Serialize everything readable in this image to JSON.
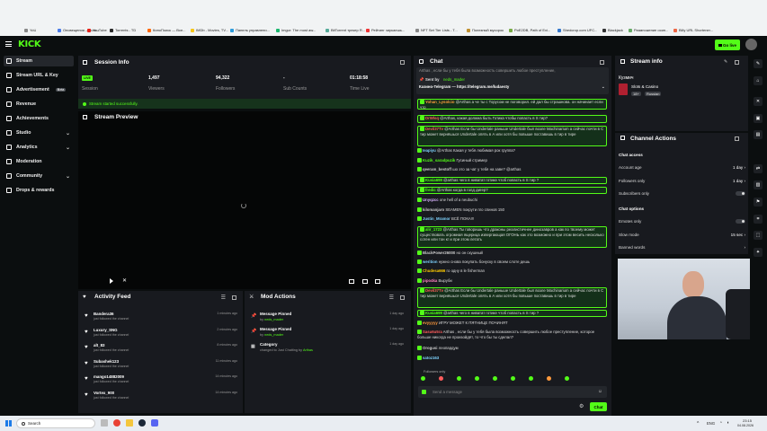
{
  "bookmarks": [
    "YoU",
    "Оповещения – Dum...",
    "YouTube",
    "Torrents - TD",
    "КиноПоиск — Все...",
    "IMDb - Movies, TV...",
    "Панель управлени...",
    "Imgur: The most aw...",
    "BitTorrent трекер R...",
    "Рейтинг чиркаешь...",
    "NFT Set Tier Lists - T...",
    "Полезный мусорок",
    "PoE2DB, Path of Exi...",
    "Shedcrop.com UFC...",
    "Blackjack",
    "Размножение осин...",
    "Billy URL Shortener..."
  ],
  "topbar": {
    "logo": "KICK",
    "go_live": "Go live"
  },
  "sidebar": {
    "items": [
      {
        "label": "Stream",
        "active": true
      },
      {
        "label": "Stream URL & Key"
      },
      {
        "label": "Advertisement",
        "badge": "Beta"
      },
      {
        "label": "Revenue"
      },
      {
        "label": "Achievements"
      },
      {
        "label": "Studio",
        "chev": true
      },
      {
        "label": "Analytics",
        "chev": true
      },
      {
        "label": "Moderation"
      },
      {
        "label": "Community",
        "chev": true
      },
      {
        "label": "Drops & rewards"
      }
    ]
  },
  "session": {
    "title": "Session Info",
    "live": "LIVE",
    "session_label": "Session",
    "viewers": "1,497",
    "viewers_label": "Viewers",
    "followers": "94,322",
    "followers_label": "Followers",
    "subs": "-",
    "subs_label": "Sub Counts",
    "time": "01:18:58",
    "time_label": "Time Live",
    "status": "Stream started successfully."
  },
  "preview": {
    "title": "Stream Preview"
  },
  "activity": {
    "title": "Activity Feed",
    "rows": [
      {
        "name": "Bandera36",
        "sub": "just followed the channel",
        "time": "1 minutes ago"
      },
      {
        "name": "Luxury_SNG",
        "sub": "just followed the channel",
        "time": "2 minutes ago"
      },
      {
        "name": "alt_83",
        "sub": "just followed the channel",
        "time": "8 minutes ago"
      },
      {
        "name": "Subashek123",
        "sub": "just followed the channel",
        "time": "11 minutes ago"
      },
      {
        "name": "mango14882009",
        "sub": "just followed the channel",
        "time": "14 minutes ago"
      },
      {
        "name": "Vortex_900",
        "sub": "just followed the channel",
        "time": "14 minutes ago"
      }
    ]
  },
  "mod": {
    "title": "Mod Actions",
    "rows": [
      {
        "name": "Message Pinned",
        "by": "by",
        "who": "neds_mader",
        "time": "1 day ago"
      },
      {
        "name": "Message Pinned",
        "by": "by",
        "who": "neds_mader",
        "time": "1 day ago"
      },
      {
        "name": "Category",
        "by": "changed to Just Chatting by",
        "who": "Arthas",
        "time": "1 day ago"
      }
    ]
  },
  "chat": {
    "title": "Chat",
    "pinned_top": "Arthas , если бы у тебя была возможность совершить любое преступление,",
    "pinned_by": "Sent by",
    "pinned_user": "neds_mader",
    "pinned_text": "Казино-Telegram — https://telegram.me/ludaesty",
    "lines": [
      {
        "user": "Yohan_Lysolcio",
        "text": "@Arthas а че ты с Торусом не поговорил. ей дал бы страшнова. он начинает если что",
        "hl": true,
        "col": "#ff9a3d"
      },
      {
        "user": "DrWlsq",
        "text": "@Arthas, какая должна быть Готика чтобы попасть в S тир?",
        "hl": true,
        "col": "#ff5c5c"
      },
      {
        "user": "Devil37Tv",
        "text": "@Arthas Если бы Undertale раньше Undertale был возле Machinarium а сейчас почти в С тир может вернёшься Undertale опять в А или хотя бы повыше поставишь в тир в тире",
        "hl": true,
        "col": "#ff5c5c"
      },
      {
        "user": "Ieapiyu",
        "text": "@Arthas Какая у тебя любимая рок группа?",
        "hl": false,
        "col": "#7fd4ff"
      },
      {
        "user": "Kuzik_saradpuzik",
        "text": "Гусиный стример",
        "hl": false,
        "col": "#53fc18"
      },
      {
        "user": "qeeram_bestoff",
        "text": "шо это за чат у тебя на заве? @arthas",
        "hl": false,
        "col": "#ccc"
      },
      {
        "user": "Kusia699",
        "text": "@arthas чего в ниватат готике чтоб попасть в S тир ?",
        "hl": true,
        "col": "#53fc18"
      },
      {
        "user": "fredic",
        "text": "@Arthas когда в голд дигер?",
        "hl": true,
        "col": "#53fc18"
      },
      {
        "user": "Unyqzcc",
        "text": "one hell of a neubuchi",
        "hl": false,
        "col": "#d9b3ff"
      },
      {
        "user": "kilomanjaro",
        "text": "SEAMEN покрути пго спинов 150",
        "hl": false,
        "col": "#ccc"
      },
      {
        "user": "Justin_Mramor",
        "text": "ВСЁ ПОКА!!!",
        "hl": false,
        "col": "#7fd4ff"
      },
      {
        "user": "alir_1723",
        "text": "@Arthas Ты говоришь что драконы реалистичнее динозавров а как по твоему может существовать огромная ящерица извергающая ОГОНЬ как это возможно и при этом весить несколько сотен или тон кг и при этом летать",
        "hl": true,
        "col": "#53fc18"
      },
      {
        "user": "BlackPower26000",
        "text": "но он скушный",
        "hl": false,
        "col": "#ccc"
      },
      {
        "user": "werition",
        "text": "нужно снова покупать бонуску в своем слоте дешь",
        "hl": false,
        "col": "#7fd4ff"
      },
      {
        "user": "Chudesa666",
        "text": "го одну в le fisherman",
        "hl": false,
        "col": "#ffcc00"
      },
      {
        "user": "pipo4ka",
        "text": "Выруби",
        "hl": false,
        "col": "#ff80c0"
      },
      {
        "user": "Devil37Tv",
        "text": "@Arthas Если бы Undertale раньше Undertale был возле Machinarium а сейчас почти в С тир может вернёшься Undertale опять в А или хотя бы повыше поставишь в тир в тире",
        "hl": true,
        "col": "#ff5c5c"
      },
      {
        "user": "Kusia699",
        "text": "@arthas чего в ниватат готике чтоб попасть в S тир ?",
        "hl": true,
        "col": "#53fc18"
      },
      {
        "user": "evyyyyy",
        "text": "ИГРУ МОЖЕТ К ПЯТНИЦЕ ПОЧИНЯТ",
        "hl": false,
        "col": "#ff9a3d"
      },
      {
        "user": "Sasu6u5ra",
        "text": "Arthas , если бы у тебя была возможность совершить любое преступление, которое больше никогда не произойдёт, то что бы ты сделал?",
        "hl": false,
        "col": "#ff5c5c"
      },
      {
        "user": "Orogusi",
        "text": "леопардум",
        "hl": false,
        "col": "#ccc"
      },
      {
        "user": "satoz163",
        "text": "",
        "hl": false,
        "col": "#7fd4ff"
      }
    ],
    "followers_only": "Followers only",
    "placeholder": "Send a message",
    "send": "Chat"
  },
  "stream_info": {
    "title": "Stream info",
    "user": "Кузмич",
    "category": "Slots & Casino",
    "tag1": "18+",
    "tag2": "Russian"
  },
  "channel_actions": {
    "title": "Channel Actions",
    "chat_access": "Chat access",
    "account_age": "Account age",
    "account_age_val": "1 day",
    "followers_only": "Followers only",
    "followers_only_val": "1 day",
    "subs_only": "Subscribers only",
    "chat_options": "Chat options",
    "emotes_only": "Emotes only",
    "slow_mode": "Slow mode",
    "slow_mode_val": "15 sec",
    "banned_words": "Banned words"
  },
  "taskbar": {
    "search": "Search",
    "lang": "ENG",
    "time": "23:15",
    "date": "04.08.2026"
  }
}
